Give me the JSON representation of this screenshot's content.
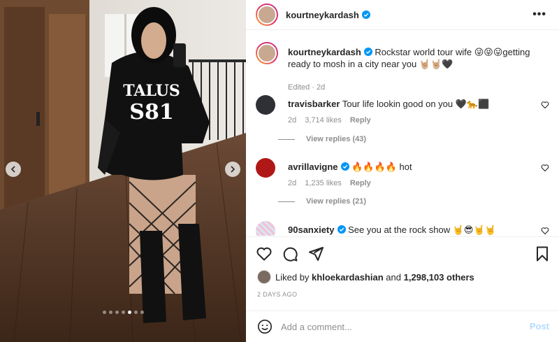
{
  "post": {
    "carousel_dot_count": 7,
    "carousel_active_index": 4
  },
  "header": {
    "username": "kourtneykardash",
    "more_label": "•••"
  },
  "caption": {
    "username": "kourtneykardash",
    "text_1": "Rockstar world tour wife",
    "emoji_1": "😜😝😛",
    "text_2": "getting ready to mosh in a city near you",
    "emoji_2": "🤘🏼🤘🏼🖤",
    "meta": "Edited · 2d"
  },
  "comments": [
    {
      "username": "travisbarker",
      "text": "Tour life lookin good on you",
      "emoji": "🖤🐆⬛",
      "time": "2d",
      "likes": "3,714 likes",
      "reply": "Reply",
      "view_replies": "View replies (43)"
    },
    {
      "username": "avrillavigne",
      "text": "hot",
      "emoji": "🔥🔥🔥🔥",
      "time": "2d",
      "likes": "1,235 likes",
      "reply": "Reply",
      "view_replies": "View replies (21)"
    },
    {
      "username": "90sanxiety",
      "text": "See you at the rock show",
      "emoji": "🤘😎🤘🤘",
      "time": "",
      "likes": "",
      "reply": ""
    }
  ],
  "likes": {
    "prefix": "Liked by",
    "user": "khloekardashian",
    "middle": "and",
    "count": "1,298,103 others"
  },
  "date": "2 DAYS AGO",
  "composer": {
    "placeholder": "Add a comment...",
    "post_label": "Post"
  },
  "colors": {
    "verified": "#0095f6",
    "post_disabled": "#b3dbff"
  }
}
